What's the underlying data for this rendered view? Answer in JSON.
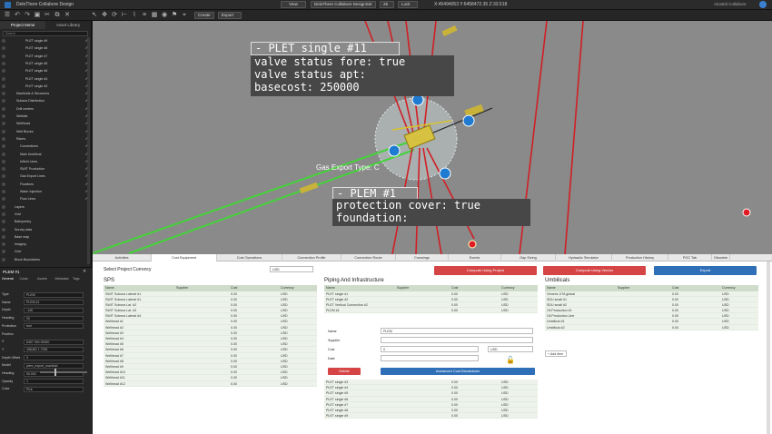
{
  "app": {
    "title": "DeloThere Collabore Design",
    "view_label": "View",
    "design_label": "DeloThere Collabore DesignSet",
    "zoom": "25",
    "lock_label": "Lock",
    "coords": "X:45494053 Y:6458472.35 Z:33.518",
    "user_label": "Alcatrid Collabore"
  },
  "toolbar": {
    "create_label": "Create",
    "export_label": "Export"
  },
  "left_panel": {
    "tabs": [
      "Project Items",
      "Asset Library"
    ],
    "search_placeholder": "Search",
    "tree": [
      {
        "label": "PLET single #9",
        "checked": true
      },
      {
        "label": "PLET single #8",
        "checked": true
      },
      {
        "label": "PLET single #7",
        "checked": true
      },
      {
        "label": "PLET single #5",
        "checked": true
      },
      {
        "label": "PLET single #6",
        "checked": true
      },
      {
        "label": "PLET single #4",
        "checked": true
      },
      {
        "label": "PLET single #3",
        "checked": true
      },
      {
        "label": "Manifolds & Structures",
        "checked": true
      },
      {
        "label": "Subsea Distribution",
        "checked": true
      },
      {
        "label": "Drill centers",
        "checked": true
      },
      {
        "label": "Wellsite",
        "checked": true
      },
      {
        "label": "Wellhead",
        "checked": true
      },
      {
        "label": "Well Blocks",
        "checked": true
      },
      {
        "label": "Risers",
        "checked": true
      },
      {
        "label": "Connections",
        "checked": true
      },
      {
        "label": "Main Umbilical",
        "checked": true
      },
      {
        "label": "Infield Lines",
        "checked": true
      },
      {
        "label": "SWIT Production",
        "checked": true
      },
      {
        "label": "Gas Export Lines",
        "checked": true
      },
      {
        "label": "Flowlines",
        "checked": true
      },
      {
        "label": "Water Injection",
        "checked": true
      },
      {
        "label": "Flow Lines",
        "checked": true
      },
      {
        "label": "Layers",
        "checked": false
      },
      {
        "label": "Grid",
        "checked": false
      },
      {
        "label": "Bathymetry",
        "checked": false
      },
      {
        "label": "Survey data",
        "checked": false
      },
      {
        "label": "Base map",
        "checked": false
      },
      {
        "label": "Imagery",
        "checked": false
      },
      {
        "label": "Grid",
        "checked": false
      },
      {
        "label": "Block Boundaries",
        "checked": false
      }
    ]
  },
  "props": {
    "title": "PLEM #1",
    "tabs": [
      "General",
      "Costs",
      "Assets",
      "Metadata",
      "Tags"
    ],
    "rows": [
      {
        "label": "Type",
        "value": "PLEM"
      },
      {
        "label": "Name",
        "value": "PLEM #1"
      },
      {
        "label": "Depth",
        "value": "-145"
      },
      {
        "label": "Heading",
        "value": "90"
      },
      {
        "label": "Protection",
        "value": "true"
      },
      {
        "label": "Position",
        "value": ""
      },
      {
        "label": "X",
        "value": "6457 000 00000"
      },
      {
        "label": "Y",
        "value": "458482 1.7050"
      },
      {
        "label": "Depth Offset",
        "value": "0"
      },
      {
        "label": "Model",
        "value": "plem_export_manifold"
      },
      {
        "label": "Heading",
        "value": "90.000"
      },
      {
        "label": "Opacity",
        "value": "1"
      },
      {
        "label": "Color",
        "value": "Pick"
      }
    ]
  },
  "scene": {
    "plet_tip": {
      "title": "- PLET single #11",
      "lines": [
        "valve status fore: true",
        "valve status apt:",
        "basecost: 250000"
      ]
    },
    "plem_tip": {
      "title": "- PLEM #1",
      "lines": [
        "protection cover: true",
        "foundation:"
      ]
    },
    "gas_label": "Gas Export Type: C"
  },
  "tabs": [
    "Activities",
    "Cost Equipment",
    "Cost Operations",
    "Connection Profile",
    "Connection Route",
    "Crossings",
    "Events",
    "Gap Sizing",
    "Hydraulic Simulator",
    "Production History",
    "POC Tab",
    "Obsolete"
  ],
  "active_tab": "Cost Equipment",
  "cost": {
    "currency_label": "Select Project Currency",
    "currency": "USD",
    "compute_project": "Compute Using Project",
    "compute_vendor": "Compute Using Vendor",
    "export_label": "Export",
    "sps": {
      "title": "SPS",
      "headers": [
        "Name",
        "Supplier",
        "Cost",
        "Currency"
      ],
      "rows": [
        [
          "SWIT Subsea Lateral #1",
          "",
          "0.00",
          "USD"
        ],
        [
          "SWIT Subsea Lateral #1",
          "",
          "0.00",
          "USD"
        ],
        [
          "SWIT Subsea Lat. #2",
          "",
          "0.00",
          "USD"
        ],
        [
          "SWIT Subsea Lat. #3",
          "",
          "0.00",
          "USD"
        ],
        [
          "SWIT Subsea Lateral #4",
          "",
          "0.00",
          "USD"
        ],
        [
          "Wellhead #1",
          "",
          "0.00",
          "USD"
        ],
        [
          "Wellhead #2",
          "",
          "0.00",
          "USD"
        ],
        [
          "Wellhead #3",
          "",
          "0.00",
          "USD"
        ],
        [
          "Wellhead #4",
          "",
          "0.00",
          "USD"
        ],
        [
          "Wellhead #5",
          "",
          "0.00",
          "USD"
        ],
        [
          "Wellhead #6",
          "",
          "0.00",
          "USD"
        ],
        [
          "Wellhead #7",
          "",
          "0.00",
          "USD"
        ],
        [
          "Wellhead #8",
          "",
          "0.00",
          "USD"
        ],
        [
          "Wellhead #9",
          "",
          "0.00",
          "USD"
        ],
        [
          "Wellhead #10",
          "",
          "0.00",
          "USD"
        ],
        [
          "Wellhead #11",
          "",
          "0.00",
          "USD"
        ],
        [
          "Wellhead #12",
          "",
          "0.00",
          "USD"
        ]
      ]
    },
    "piping": {
      "title": "Piping And Infrastructure",
      "headers": [
        "Name",
        "Supplier",
        "Cost",
        "Currency"
      ],
      "rows_top": [
        [
          "PLET single #1",
          "",
          "0.00",
          "USD"
        ],
        [
          "PLET single #2",
          "",
          "0.00",
          "USD"
        ],
        [
          "PLET Vertical Connection #2",
          "",
          "0.00",
          "USD"
        ],
        [
          "PLEM #1",
          "",
          "0.00",
          "USD"
        ]
      ],
      "edit": {
        "name_label": "Name",
        "name": "PLEM",
        "supplier_label": "Supplier",
        "cost_label": "Cost",
        "cost": "0",
        "currency": "USD",
        "date_label": "Date",
        "delete_label": "Delete",
        "advanced_label": "Advanced Cost Breakdown"
      },
      "rows_bottom": [
        [
          "PLET single #3",
          "",
          "0.00",
          "USD"
        ],
        [
          "PLET single #4",
          "",
          "0.00",
          "USD"
        ],
        [
          "PLET single #5",
          "",
          "0.00",
          "USD"
        ],
        [
          "PLET single #6",
          "",
          "0.00",
          "USD"
        ],
        [
          "PLET single #7",
          "",
          "0.00",
          "USD"
        ],
        [
          "PLET single #8",
          "",
          "0.00",
          "USD"
        ],
        [
          "PLET single #9",
          "",
          "0.00",
          "USD"
        ]
      ]
    },
    "umbilicals": {
      "title": "Umbilicals",
      "headers": [
        "Name",
        "Supplier",
        "Cost",
        "Currency"
      ],
      "rows": [
        [
          "Generic UTA global",
          "",
          "0.00",
          "USD"
        ],
        [
          "SDU small #1",
          "",
          "0.00",
          "USD"
        ],
        [
          "SDU small #2",
          "",
          "0.00",
          "USD"
        ],
        [
          "Oil Production #1",
          "",
          "0.00",
          "USD"
        ],
        [
          "Oil Production Line",
          "",
          "0.00",
          "USD"
        ],
        [
          "Umbilical #1",
          "",
          "0.00",
          "USD"
        ],
        [
          "Umbilical #2",
          "",
          "0.00",
          "USD"
        ]
      ],
      "add_label": "+ Add item"
    }
  }
}
